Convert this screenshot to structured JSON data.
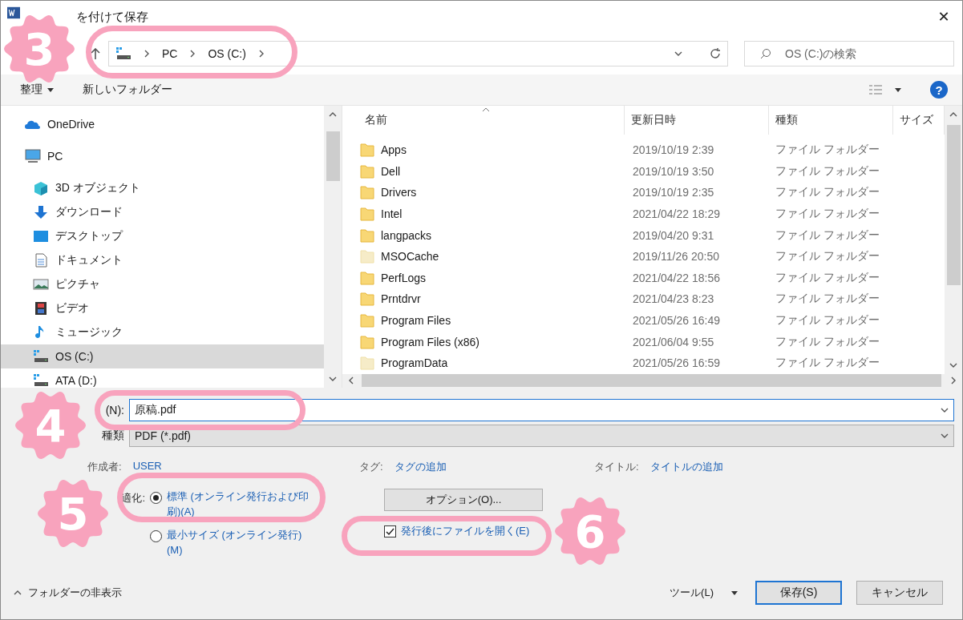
{
  "window": {
    "title": "を付けて保存",
    "close": "✕"
  },
  "address": {
    "crumbs": [
      "PC",
      "OS (C:)"
    ],
    "search_placeholder": "OS (C:)の検索"
  },
  "toolbar": {
    "organize": "整理",
    "new_folder": "新しいフォルダー",
    "help": "?"
  },
  "nav": [
    {
      "label": "OneDrive",
      "kind": "cloud",
      "selected": false
    },
    {
      "label": "PC",
      "kind": "pc",
      "selected": false,
      "children": [
        {
          "label": "3D オブジェクト",
          "kind": "cube",
          "selected": false
        },
        {
          "label": "ダウンロード",
          "kind": "download",
          "selected": false
        },
        {
          "label": "デスクトップ",
          "kind": "desktop",
          "selected": false
        },
        {
          "label": "ドキュメント",
          "kind": "document",
          "selected": false
        },
        {
          "label": "ピクチャ",
          "kind": "image",
          "selected": false
        },
        {
          "label": "ビデオ",
          "kind": "film",
          "selected": false
        },
        {
          "label": "ミュージック",
          "kind": "music",
          "selected": false
        },
        {
          "label": "OS (C:)",
          "kind": "drive",
          "selected": true
        },
        {
          "label": "ATA (D:)",
          "kind": "drive",
          "selected": false
        }
      ]
    }
  ],
  "table": {
    "columns": [
      "名前",
      "更新日時",
      "種類",
      "サイズ"
    ],
    "rows": [
      {
        "name": "Apps",
        "modified": "2019/10/19 2:39",
        "type": "ファイル フォルダー",
        "hidden": false
      },
      {
        "name": "Dell",
        "modified": "2019/10/19 3:50",
        "type": "ファイル フォルダー",
        "hidden": false
      },
      {
        "name": "Drivers",
        "modified": "2019/10/19 2:35",
        "type": "ファイル フォルダー",
        "hidden": false
      },
      {
        "name": "Intel",
        "modified": "2021/04/22 18:29",
        "type": "ファイル フォルダー",
        "hidden": false
      },
      {
        "name": "langpacks",
        "modified": "2019/04/20 9:31",
        "type": "ファイル フォルダー",
        "hidden": false
      },
      {
        "name": "MSOCache",
        "modified": "2019/11/26 20:50",
        "type": "ファイル フォルダー",
        "hidden": true
      },
      {
        "name": "PerfLogs",
        "modified": "2021/04/22 18:56",
        "type": "ファイル フォルダー",
        "hidden": false
      },
      {
        "name": "Prntdrvr",
        "modified": "2021/04/23 8:23",
        "type": "ファイル フォルダー",
        "hidden": false
      },
      {
        "name": "Program Files",
        "modified": "2021/05/26 16:49",
        "type": "ファイル フォルダー",
        "hidden": false
      },
      {
        "name": "Program Files (x86)",
        "modified": "2021/06/04 9:55",
        "type": "ファイル フォルダー",
        "hidden": false
      },
      {
        "name": "ProgramData",
        "modified": "2021/05/26 16:59",
        "type": "ファイル フォルダー",
        "hidden": true
      }
    ]
  },
  "form": {
    "filename_label": "(N):",
    "filename": "原稿.pdf",
    "type_label": "種類",
    "type_value": "PDF (*.pdf)",
    "meta": [
      {
        "label": "作成者:",
        "value": "USER"
      },
      {
        "label": "タグ:",
        "value": "タグの追加"
      },
      {
        "label": "タイトル:",
        "value": "タイトルの追加"
      }
    ],
    "optimize_label": "適化:",
    "optimize_options": [
      {
        "label": "標準 (オンライン発行および印刷)(A)",
        "selected": true
      },
      {
        "label": "最小サイズ (オンライン発行)(M)",
        "selected": false
      }
    ],
    "options_button": "オプション(O)...",
    "open_after": {
      "label": "発行後にファイルを開く(E)",
      "checked": true
    }
  },
  "footer": {
    "hide_folders": "フォルダーの非表示",
    "tools": "ツール(L)",
    "save": "保存(S)",
    "cancel": "キャンセル"
  },
  "annotations": [
    {
      "number": "3"
    },
    {
      "number": "4"
    },
    {
      "number": "5"
    },
    {
      "number": "6"
    }
  ]
}
